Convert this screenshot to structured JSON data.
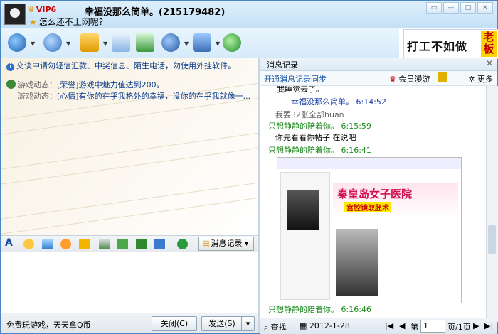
{
  "window": {
    "vip_label": "VIP6",
    "contact_name": "幸福没那么简单。(215179482)",
    "signature": "怎么还不上网呢?"
  },
  "toolbar": {
    "icons": [
      "video-icon",
      "voice-icon",
      "file-transfer-icon",
      "mail-icon",
      "send-sms-icon",
      "remote-assist-icon",
      "apps-icon",
      "safety-icon"
    ]
  },
  "ad": {
    "text": "打工不如做",
    "badge": "老板"
  },
  "chat": {
    "notice": "交谈中请勿轻信汇款、中奖信息、陌生电话，勿使用外挂软件。",
    "dynamics": [
      {
        "label": "游戏动态：",
        "value": "[荣誉]游戏中魅力值达到200。"
      },
      {
        "label": "游戏动态：",
        "value": "[心情]有你的在乎我格外的幸福，没你的在乎我就像一..."
      }
    ]
  },
  "format_bar": {
    "history_button": "消息记录"
  },
  "bottom": {
    "promo": "免费玩游戏，天天拿Q币",
    "close_button": "关闭(C)",
    "send_button": "发送(S)"
  },
  "history": {
    "title": "消息记录",
    "sync": "开通消息记录同步",
    "member": "会员漫游",
    "more": "更多",
    "messages": [
      {
        "text": "我睡觉去了。",
        "kind": "plain"
      },
      {
        "text": "幸福没那么简单。 6:14:52",
        "kind": "them"
      },
      {
        "text": "我要32张全部huan",
        "kind": "gray"
      },
      {
        "text": "只想静静的陪着你。 6:15:59",
        "kind": "me"
      },
      {
        "text": "你先看看你帖子 在说吧",
        "kind": "plain"
      },
      {
        "text": "只想静静的陪着你。 6:16:41",
        "kind": "me"
      },
      {
        "text": "只想静静的陪着你。 6:16:46",
        "kind": "me"
      }
    ],
    "image": {
      "banner_title": "秦皇岛女子医院",
      "banner_sub": "宫腔镜取胚术"
    },
    "footer": {
      "find": "查找",
      "date": "2012-1-28",
      "page_label": "第",
      "page_value": "1",
      "page_total": "页/1页"
    }
  }
}
